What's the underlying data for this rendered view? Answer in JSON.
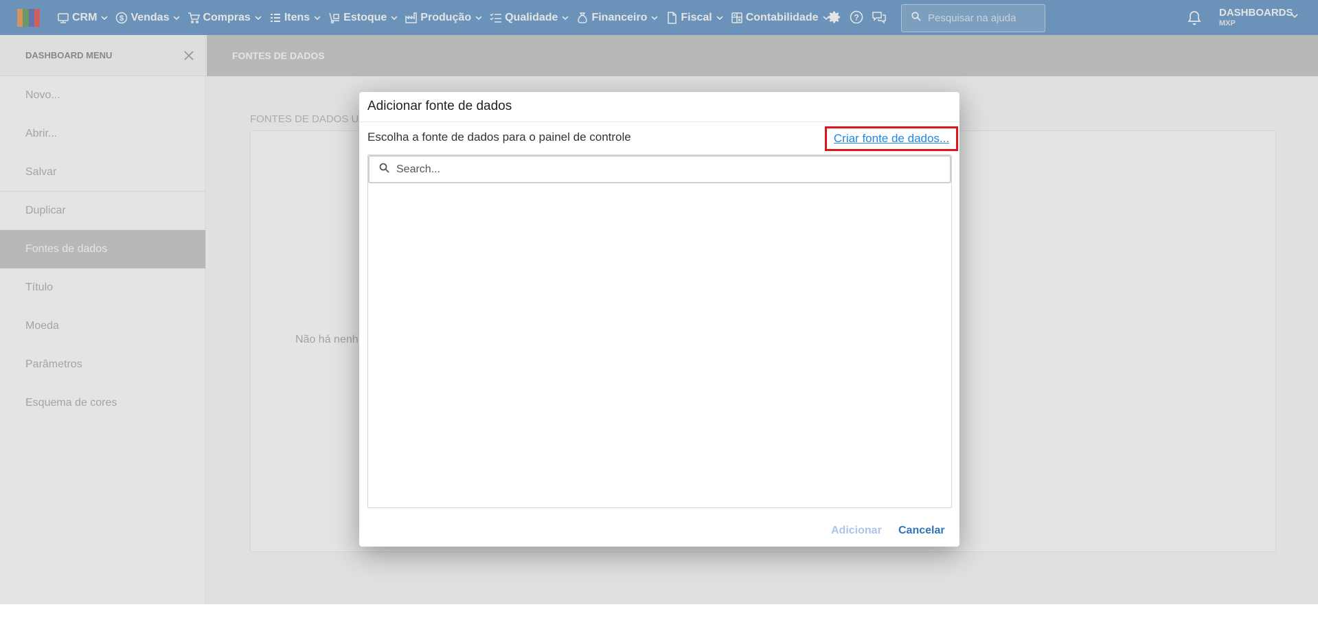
{
  "topbar": {
    "logo_colors": [
      "#e8731a",
      "#2e7d32",
      "#1f3f99",
      "#d81b1b"
    ],
    "nav": [
      {
        "label": "CRM",
        "icon": "crm-icon"
      },
      {
        "label": "Vendas",
        "icon": "dollar-circle-icon"
      },
      {
        "label": "Compras",
        "icon": "cart-icon"
      },
      {
        "label": "Itens",
        "icon": "items-icon"
      },
      {
        "label": "Estoque",
        "icon": "hand-truck-icon"
      },
      {
        "label": "Produção",
        "icon": "factory-icon"
      },
      {
        "label": "Qualidade",
        "icon": "checklist-icon"
      },
      {
        "label": "Financeiro",
        "icon": "money-bag-icon"
      },
      {
        "label": "Fiscal",
        "icon": "document-icon"
      },
      {
        "label": "Contabilidade",
        "icon": "calculator-icon"
      }
    ],
    "help_placeholder": "Pesquisar na ajuda",
    "user": {
      "module": "DASHBOARDS",
      "company": "MXP"
    },
    "accent": "#2f74b5"
  },
  "sidebar": {
    "title": "DASHBOARD MENU",
    "items": [
      {
        "label": "Novo..."
      },
      {
        "label": "Abrir..."
      },
      {
        "label": "Salvar"
      },
      {
        "label": "Duplicar"
      },
      {
        "label": "Fontes de dados"
      },
      {
        "label": "Título"
      },
      {
        "label": "Moeda"
      },
      {
        "label": "Parâmetros"
      },
      {
        "label": "Esquema de cores"
      }
    ],
    "active_index": 4
  },
  "main": {
    "header_title": "FONTES DE DADOS",
    "section_label": "FONTES DE DADOS UT",
    "empty_text": "Não há nenh"
  },
  "dialog": {
    "title": "Adicionar fonte de dados",
    "subtitle": "Escolha a fonte de dados para o painel de controle",
    "create_link": "Criar fonte de dados...",
    "search_placeholder": "Search...",
    "add_label": "Adicionar",
    "cancel_label": "Cancelar",
    "highlight_color": "#e0141c"
  }
}
